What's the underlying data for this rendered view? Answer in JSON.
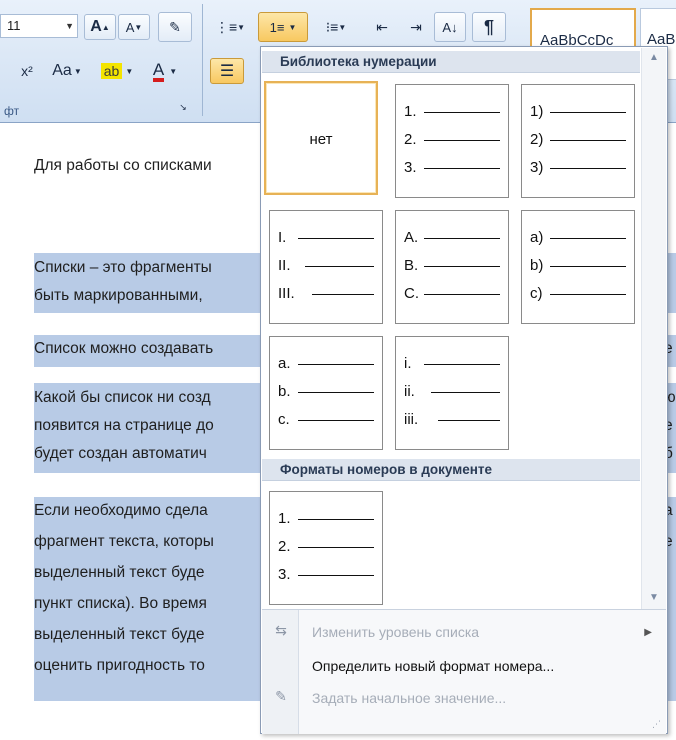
{
  "ribbon": {
    "font_size": "11",
    "grow_font": "A",
    "shrink_font": "A",
    "superscript": "x²",
    "change_case": "Aa",
    "font_color": "A",
    "group_label": "фт",
    "sort": "A↓",
    "pilcrow": "¶",
    "style_preview": "AaBbCcDc",
    "style_preview2": "AaBb"
  },
  "document": {
    "line1": "Для работы со списками",
    "para1_line1": "Списки – это фрагменты",
    "para1_line2": "быть маркированными,",
    "para2_line1": "Список можно создавать",
    "para2_right": "е",
    "para3_line1": "Какой бы список ни созд",
    "para3_line2": "появится на странице до",
    "para3_line3": "будет создан автоматич",
    "para3_right1": "ю",
    "para3_right2": "е",
    "para3_right3": "б",
    "para4_line1": "Если необходимо сдела",
    "para4_line2": "фрагмент текста, которы",
    "para4_line3": "выделенный текст буде",
    "para4_line4": "пункт списка). Во время",
    "para4_line5": "выделенный текст буде",
    "para4_line6": "оценить пригодность то",
    "para4_right1": "а",
    "para4_right2": "е"
  },
  "panel": {
    "library_header": "Библиотека нумерации",
    "none_label": "нет",
    "formats": [
      {
        "marks": [
          "1.",
          "2.",
          "3."
        ]
      },
      {
        "marks": [
          "1)",
          "2)",
          "3)"
        ]
      },
      {
        "marks": [
          "I.",
          "II.",
          "III."
        ]
      },
      {
        "marks": [
          "A.",
          "B.",
          "C."
        ]
      },
      {
        "marks": [
          "a)",
          "b)",
          "c)"
        ]
      },
      {
        "marks": [
          "a.",
          "b.",
          "c."
        ]
      },
      {
        "marks": [
          "i.",
          "ii.",
          "iii."
        ]
      }
    ],
    "document_header": "Форматы номеров в документе",
    "document_format": {
      "marks": [
        "1.",
        "2.",
        "3."
      ]
    },
    "menu": {
      "change_level": "Изменить уровень списка",
      "define_new": "Определить новый формат номера...",
      "set_start": "Задать начальное значение..."
    }
  }
}
